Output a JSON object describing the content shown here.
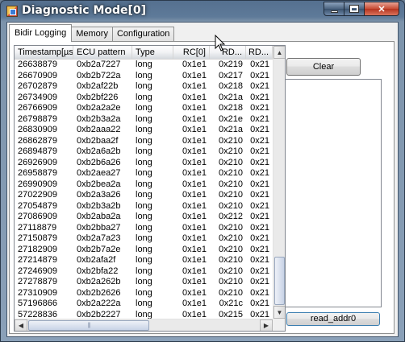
{
  "window": {
    "title": "Diagnostic Mode[0]",
    "controls": {
      "minimize": "minimize",
      "maximize": "maximize",
      "close": "✕"
    }
  },
  "tabs": [
    {
      "label": "Bidir Logging",
      "active": true
    },
    {
      "label": "Memory",
      "active": false
    },
    {
      "label": "Configuration",
      "active": false
    }
  ],
  "table": {
    "columns": [
      "Timestamp[µs]",
      "ECU pattern",
      "Type",
      "RC[0]",
      "RD...",
      "RD..."
    ],
    "rows": [
      [
        "26638879",
        "0xb2a7227",
        "long",
        "0x1e1",
        "0x219",
        "0x21"
      ],
      [
        "26670909",
        "0xb2b722a",
        "long",
        "0x1e1",
        "0x217",
        "0x21"
      ],
      [
        "26702879",
        "0xb2af22b",
        "long",
        "0x1e1",
        "0x218",
        "0x21"
      ],
      [
        "26734909",
        "0xb2bf226",
        "long",
        "0x1e1",
        "0x21a",
        "0x21"
      ],
      [
        "26766909",
        "0xb2a2a2e",
        "long",
        "0x1e1",
        "0x218",
        "0x21"
      ],
      [
        "26798879",
        "0xb2b3a2a",
        "long",
        "0x1e1",
        "0x21e",
        "0x21"
      ],
      [
        "26830909",
        "0xb2aaa22",
        "long",
        "0x1e1",
        "0x21a",
        "0x21"
      ],
      [
        "26862879",
        "0xb2baa2f",
        "long",
        "0x1e1",
        "0x210",
        "0x21"
      ],
      [
        "26894879",
        "0xb2a6a2b",
        "long",
        "0x1e1",
        "0x210",
        "0x21"
      ],
      [
        "26926909",
        "0xb2b6a26",
        "long",
        "0x1e1",
        "0x210",
        "0x21"
      ],
      [
        "26958879",
        "0xb2aea27",
        "long",
        "0x1e1",
        "0x210",
        "0x21"
      ],
      [
        "26990909",
        "0xb2bea2a",
        "long",
        "0x1e1",
        "0x210",
        "0x21"
      ],
      [
        "27022909",
        "0xb2a3a26",
        "long",
        "0x1e1",
        "0x210",
        "0x21"
      ],
      [
        "27054879",
        "0xb2b3a2b",
        "long",
        "0x1e1",
        "0x210",
        "0x21"
      ],
      [
        "27086909",
        "0xb2aba2a",
        "long",
        "0x1e1",
        "0x212",
        "0x21"
      ],
      [
        "27118879",
        "0xb2bba27",
        "long",
        "0x1e1",
        "0x210",
        "0x21"
      ],
      [
        "27150879",
        "0xb2a7a23",
        "long",
        "0x1e1",
        "0x210",
        "0x21"
      ],
      [
        "27182909",
        "0xb2b7a2e",
        "long",
        "0x1e1",
        "0x210",
        "0x21"
      ],
      [
        "27214879",
        "0xb2afa2f",
        "long",
        "0x1e1",
        "0x210",
        "0x21"
      ],
      [
        "27246909",
        "0xb2bfa22",
        "long",
        "0x1e1",
        "0x210",
        "0x21"
      ],
      [
        "27278879",
        "0xb2a262b",
        "long",
        "0x1e1",
        "0x210",
        "0x21"
      ],
      [
        "27310909",
        "0xb2b2626",
        "long",
        "0x1e1",
        "0x210",
        "0x21"
      ],
      [
        "57196866",
        "0xb2a222a",
        "long",
        "0x1e1",
        "0x21c",
        "0x21"
      ],
      [
        "57228836",
        "0xb2b2227",
        "long",
        "0x1e1",
        "0x215",
        "0x21"
      ]
    ]
  },
  "scroll": {
    "up_arrow": "▲",
    "down_arrow": "▼",
    "left_arrow": "◀",
    "right_arrow": "▶",
    "grip": "|||"
  },
  "buttons": {
    "clear": "Clear",
    "read_addr": "read_addr0"
  },
  "colors": {
    "window_frame": "#5e7a99",
    "close_button": "#c74a33",
    "focus_border": "#3c7fb1"
  }
}
